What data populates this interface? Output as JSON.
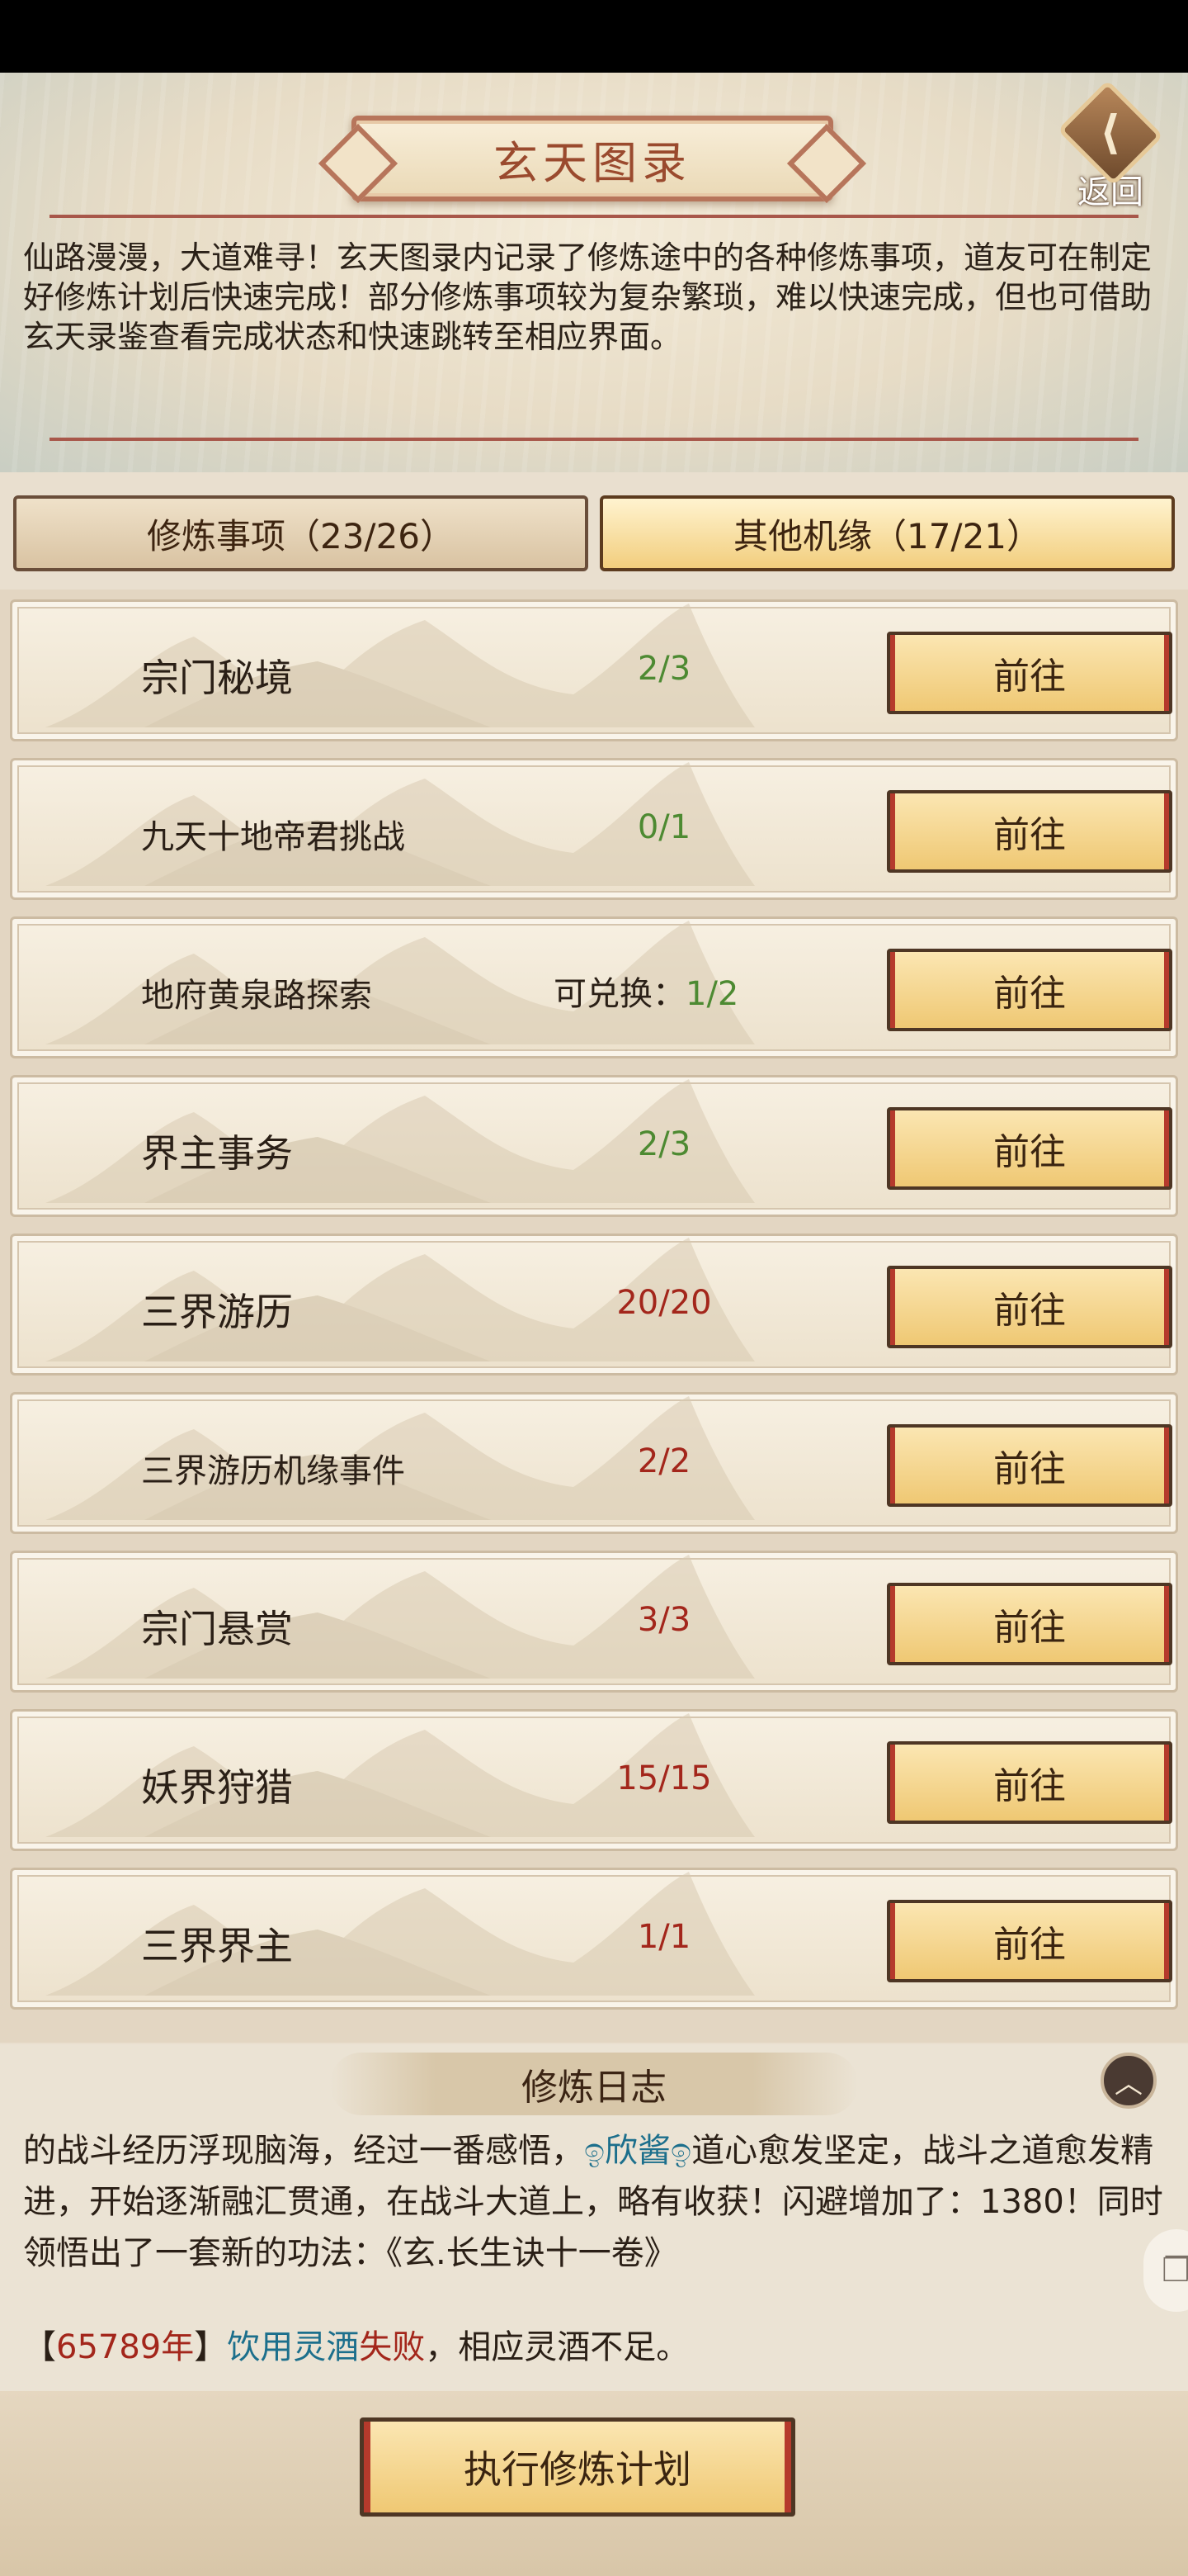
{
  "header": {
    "title": "玄天图录",
    "back_label": "返回",
    "back_glyph": "⟨",
    "intro": "仙路漫漫，大道难寻！玄天图录内记录了修炼途中的各种修炼事项，道友可在制定好修炼计划后快速完成！部分修炼事项较为复杂繁琐，难以快速完成，但也可借助玄天录鉴查看完成状态和快速跳转至相应界面。"
  },
  "tabs": [
    {
      "label": "修炼事项（23/26）",
      "active": false
    },
    {
      "label": "其他机缘（17/21）",
      "active": true
    }
  ],
  "go_label": "前往",
  "items": [
    {
      "name": "宗门秘境",
      "count": "2/3",
      "status": "incomplete"
    },
    {
      "name": "九天十地帝君挑战",
      "count": "0/1",
      "status": "incomplete"
    },
    {
      "name": "地府黄泉路探索",
      "exchange_label": "可兑换：",
      "count": "1/2",
      "status": "incomplete"
    },
    {
      "name": "界主事务",
      "count": "2/3",
      "status": "incomplete"
    },
    {
      "name": "三界游历",
      "count": "20/20",
      "status": "complete"
    },
    {
      "name": "三界游历机缘事件",
      "count": "2/2",
      "status": "complete"
    },
    {
      "name": "宗门悬赏",
      "count": "3/3",
      "status": "complete"
    },
    {
      "name": "妖界狩猎",
      "count": "15/15",
      "status": "complete"
    },
    {
      "name": "三界界主",
      "count": "1/1",
      "status": "complete"
    }
  ],
  "log": {
    "title": "修炼日志",
    "collapse_glyph": "︿",
    "p1_a": "的战斗经历浮现脑海，经过一番感悟，",
    "p1_name": "ඉ欣酱ඉ",
    "p1_b": "道心愈发坚定，战斗之道愈发精进，开始逐渐融汇贯通，在战斗大道上，略有收获！闪避增加了：1380！同时领悟出了一套新的功法：《玄.长生诀十一卷》",
    "p2_open": "【",
    "p2_year": "65789年",
    "p2_close": "】",
    "p2_act": "饮用灵酒",
    "p2_fail": "失败",
    "p2_rest": "，相应灵酒不足。"
  },
  "execute_label": "执行修炼计划",
  "colors": {
    "incomplete": "#4d8a32",
    "complete": "#a3261b",
    "accent": "#b53a2c"
  }
}
